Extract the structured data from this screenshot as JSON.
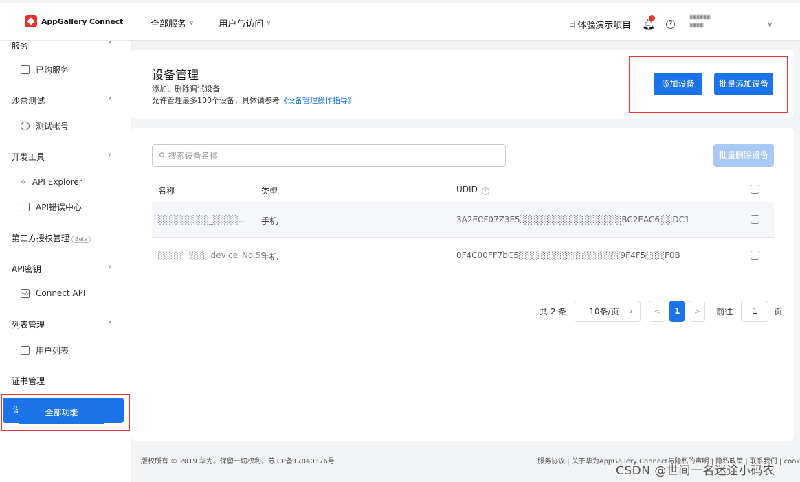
{
  "header": {
    "logo_text": "AppGallery Connect",
    "nav": [
      {
        "label": "全部服务"
      },
      {
        "label": "用户与访问"
      }
    ],
    "demo_label": "体验演示项目",
    "notification_count": "1",
    "help_symbol": "?"
  },
  "sidebar": {
    "groups": [
      {
        "label": "服务"
      },
      {
        "label": "沙盒测试"
      },
      {
        "label": "开发工具"
      },
      {
        "label": "第三方授权管理"
      },
      {
        "label": "API密钥"
      },
      {
        "label": "列表管理"
      },
      {
        "label": "证书管理"
      }
    ],
    "items": [
      {
        "label": "已购服务"
      },
      {
        "label": "测试帐号"
      },
      {
        "label": "API Explorer"
      },
      {
        "label": "API错误中心"
      },
      {
        "label": "Connect API"
      },
      {
        "label": "用户列表"
      }
    ],
    "beta_label": "Beta",
    "active_label": "设备管理",
    "all_functions_label": "全部功能"
  },
  "page": {
    "title": "设备管理",
    "desc1": "添加、删除调试设备",
    "desc2": "允许管理最多100个设备，具体请参考",
    "desc2_link": "《设备管理操作指导》",
    "add_label": "添加设备",
    "batch_add_label": "批量添加设备"
  },
  "list": {
    "search_placeholder": "搜索设备名称",
    "batch_delete_label": "批量删除设备",
    "columns": [
      "名称",
      "类型",
      "UDID"
    ],
    "rows": [
      {
        "name": "░░░░░░░░_░░░░...",
        "type": "手机",
        "udid": "3A2ECF07Z3E5░░░░░░░░░░░░░░░░BC2EAC6░░DC1"
      },
      {
        "name": "░░░░_░░░_device_No.59...",
        "type": "手机",
        "udid": "0F4C00FF7bC5░░░░░░░░░░░░░░░░9F4F5░░░F0B"
      }
    ]
  },
  "pager": {
    "total": "共 2 条",
    "page_size": "10条/页",
    "prev": "<",
    "current": "1",
    "next": ">",
    "jump_label": "前往",
    "jump_value": "1",
    "page_suffix": "页"
  },
  "footer": {
    "copyright": "版权所有 © 2019 华为。保留一切权利。苏ICP备17040376号",
    "links": "服务协议 | 关于华为AppGallery Connect与隐私的声明 | 隐私政策 | 联系我们 | cookies"
  },
  "watermark": "CSDN @世间一名迷途小码农"
}
